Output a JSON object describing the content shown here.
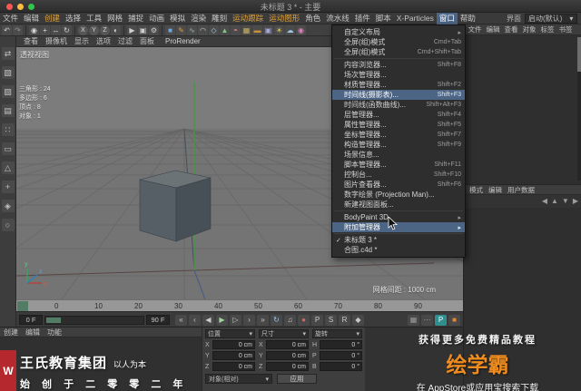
{
  "titlebar": {
    "title": "未标题 3 * - 主要"
  },
  "menubar": {
    "items": [
      "文件",
      "编辑",
      "创建",
      "选择",
      "工具",
      "网格",
      "捕捉",
      "动画",
      "模拟",
      "渲染",
      "雕刻",
      "运动跟踪",
      "运动图形",
      "角色",
      "流水线",
      "插件",
      "脚本",
      "X-Particles",
      "窗口",
      "帮助"
    ],
    "active_item": "窗口",
    "orange_items": [
      "创建",
      "运动跟踪",
      "运动图形"
    ],
    "interface_label": "界面",
    "layout_value": "启动(默认)"
  },
  "glyphs": {
    "check": "✓",
    "submenu_arrow": "▸",
    "dropdown_arrow": "▾"
  },
  "window_menu": {
    "items": [
      {
        "label": "自定义布局",
        "submenu": true
      },
      {
        "label": "全屏(组)模式",
        "shortcut": "Cmd+Tab"
      },
      {
        "label": "全屏(组)模式",
        "shortcut": "Cmd+Shift+Tab",
        "sep": true
      },
      {
        "label": "内容浏览器...",
        "shortcut": "Shift+F8"
      },
      {
        "label": "场次管理器..."
      },
      {
        "label": "材质管理器...",
        "shortcut": "Shift+F2"
      },
      {
        "label": "时间线(摄影表)...",
        "shortcut": "Shift+F3",
        "highlighted": true
      },
      {
        "label": "时间线(函数曲线)...",
        "shortcut": "Shift+Alt+F3"
      },
      {
        "label": "层管理器...",
        "shortcut": "Shift+F4"
      },
      {
        "label": "属性管理器...",
        "shortcut": "Shift+F5"
      },
      {
        "label": "坐标管理器...",
        "shortcut": "Shift+F7"
      },
      {
        "label": "构造管理器...",
        "shortcut": "Shift+F9"
      },
      {
        "label": "场景信息..."
      },
      {
        "label": "脚本管理器...",
        "shortcut": "Shift+F11"
      },
      {
        "label": "控制台...",
        "shortcut": "Shift+F10"
      },
      {
        "label": "图片查看器...",
        "shortcut": "Shift+F6"
      },
      {
        "label": "数字绘景 (Projection Man)..."
      },
      {
        "label": "新建视图面板...",
        "sep": true
      },
      {
        "label": "BodyPaint 3D",
        "submenu": true
      },
      {
        "label": "附加管理器",
        "submenu": true,
        "hovered": true,
        "sep": true
      },
      {
        "label": "未标题 3 *",
        "checked": true
      },
      {
        "label": "合图.c4d *"
      }
    ]
  },
  "toolbar": {
    "icons": [
      {
        "name": "undo-icon",
        "glyph": "↶",
        "color": "#d0d0d0"
      },
      {
        "name": "redo-icon",
        "glyph": "↷",
        "color": "#979797"
      },
      {
        "separator": true
      },
      {
        "name": "live-selection-icon",
        "glyph": "◉",
        "color": "#d8d8d8"
      },
      {
        "name": "move-tool-icon",
        "glyph": "+",
        "color": "#d8d8d8"
      },
      {
        "name": "scale-tool-icon",
        "glyph": "↔",
        "color": "#d8d8d8"
      },
      {
        "name": "rotate-tool-icon",
        "glyph": "↻",
        "color": "#d8d8d8"
      },
      {
        "separator": true
      },
      {
        "name": "lock-x-icon",
        "glyph": "X",
        "color": "#d8d8d8",
        "circle": true
      },
      {
        "name": "lock-y-icon",
        "glyph": "Y",
        "color": "#d8d8d8",
        "circle": true
      },
      {
        "name": "lock-z-icon",
        "glyph": "Z",
        "color": "#d8d8d8",
        "circle": true
      },
      {
        "name": "coordinate-system-icon",
        "glyph": "◐",
        "color": "#d8d8d8"
      },
      {
        "separator": true
      },
      {
        "name": "render-view-icon",
        "glyph": "▶",
        "color": "#cfcfcf"
      },
      {
        "name": "render-picture-viewer-icon",
        "glyph": "▣",
        "color": "#cfcfcf"
      },
      {
        "name": "render-settings-icon",
        "glyph": "⚙",
        "color": "#cfcfcf"
      },
      {
        "separator": true
      },
      {
        "name": "add-cube-icon",
        "glyph": "■",
        "color": "#6fa8dc"
      },
      {
        "name": "add-pen-icon",
        "glyph": "✎",
        "color": "#d8a23c"
      },
      {
        "name": "add-spline-icon",
        "glyph": "∿",
        "color": "#8cc98c"
      },
      {
        "name": "add-arc-icon",
        "glyph": "◠",
        "color": "#c8c8c8"
      },
      {
        "name": "add-subdivision-icon",
        "glyph": "◇",
        "color": "#9ad0e8"
      },
      {
        "name": "add-extrude-icon",
        "glyph": "▲",
        "color": "#84c784"
      },
      {
        "name": "add-boolean-icon",
        "glyph": "◓",
        "color": "#d08484"
      },
      {
        "name": "add-array-icon",
        "glyph": "▦",
        "color": "#c8b060"
      },
      {
        "name": "add-floor-icon",
        "glyph": "▬",
        "color": "#c98f3b"
      },
      {
        "name": "add-camera-icon",
        "glyph": "▣",
        "color": "#a8a8d8"
      },
      {
        "name": "add-light-icon",
        "glyph": "☀",
        "color": "#ecd24a"
      },
      {
        "name": "add-sky-icon",
        "glyph": "☁",
        "color": "#9ec7ec"
      },
      {
        "name": "add-material-icon",
        "glyph": "◉",
        "color": "#d884b8"
      }
    ]
  },
  "left_toolbar": {
    "icons": [
      {
        "name": "convert-tool-icon",
        "glyph": "⇄"
      },
      {
        "name": "model-mode-icon",
        "glyph": "▧"
      },
      {
        "name": "texture-mode-icon",
        "glyph": "▨"
      },
      {
        "name": "workplane-mode-icon",
        "glyph": "▤"
      },
      {
        "name": "points-mode-icon",
        "glyph": "∷"
      },
      {
        "name": "edges-mode-icon",
        "glyph": "▭"
      },
      {
        "name": "polygons-mode-icon",
        "glyph": "△"
      },
      {
        "name": "enable-axis-icon",
        "glyph": "+"
      },
      {
        "name": "snap-icon",
        "glyph": "◈"
      },
      {
        "name": "magnet-icon",
        "glyph": "○"
      }
    ]
  },
  "viewport": {
    "title": "透视视图",
    "menu": [
      "查看",
      "摄像机",
      "显示",
      "选项",
      "过滤",
      "面板"
    ],
    "prorender_label": "ProRender",
    "hud_lines": [
      "三角形 : 24",
      "多边形 : 6",
      "顶点 : 8",
      "对象 : 1"
    ],
    "grid_spacing": "网格间距 : 1000 cm",
    "axis_labels": [
      "x",
      "y",
      "z"
    ]
  },
  "object_manager": {
    "menu": [
      "文件",
      "编辑",
      "查看",
      "对象",
      "标签",
      "书签"
    ]
  },
  "attribute_manager": {
    "menu": [
      "模式",
      "编辑",
      "用户数据"
    ],
    "nav_icons": [
      "◀",
      "▲",
      "▼",
      "▶"
    ]
  },
  "timeline": {
    "ticks": [
      "0",
      "10",
      "20",
      "30",
      "40",
      "50",
      "60",
      "70",
      "80",
      "90"
    ],
    "start_field": "0 F",
    "end_field": "90 F"
  },
  "transport": {
    "buttons": [
      {
        "name": "goto-start-button",
        "glyph": "«"
      },
      {
        "name": "prev-key-button",
        "glyph": "‹"
      },
      {
        "name": "prev-frame-button",
        "glyph": "◀"
      },
      {
        "name": "play-button",
        "glyph": "▶",
        "color": "#9fd49f"
      },
      {
        "name": "next-frame-button",
        "glyph": "▷"
      },
      {
        "name": "next-key-button",
        "glyph": "›"
      },
      {
        "name": "goto-end-button",
        "glyph": "»"
      },
      {
        "name": "loop-button",
        "glyph": "↻",
        "color": "#9fc4e8"
      },
      {
        "name": "sound-button",
        "glyph": "♫"
      },
      {
        "name": "record-button",
        "glyph": "●",
        "color": "#e06060"
      },
      {
        "name": "key-position-button",
        "glyph": "P"
      },
      {
        "name": "key-scale-button",
        "glyph": "S"
      },
      {
        "name": "key-rotation-button",
        "glyph": "R"
      },
      {
        "name": "key-parameter-button",
        "glyph": "◆",
        "color": "#c8c8c8"
      }
    ],
    "right_icons": [
      {
        "name": "solo-icon",
        "glyph": "▦",
        "color": "#9a9a9a"
      },
      {
        "name": "options-dots-icon",
        "glyph": "⋯",
        "color": "#9a9a9a"
      },
      {
        "name": "prorender-badge",
        "glyph": "P",
        "color": "#ffffff",
        "bg": "#2f8f8f"
      },
      {
        "name": "plugin-badge",
        "glyph": "■",
        "color": "#e8872b"
      }
    ]
  },
  "material_manager": {
    "menu": [
      "创建",
      "编辑",
      "功能"
    ]
  },
  "coordinate_manager": {
    "columns": [
      {
        "title": "位置",
        "rows": [
          [
            "X",
            "0 cm"
          ],
          [
            "Y",
            "0 cm"
          ],
          [
            "Z",
            "0 cm"
          ]
        ]
      },
      {
        "title": "尺寸",
        "rows": [
          [
            "X",
            "0 cm"
          ],
          [
            "Y",
            "0 cm"
          ],
          [
            "Z",
            "0 cm"
          ]
        ]
      },
      {
        "title": "旋转",
        "rows": [
          [
            "H",
            "0 °"
          ],
          [
            "P",
            "0 °"
          ],
          [
            "B",
            "0 °"
          ]
        ]
      }
    ],
    "mode_value": "对象(相对)",
    "apply_label": "应用"
  },
  "ads": {
    "left_logo": "W",
    "left_title": "王氏教育集团",
    "left_slogan": "以人为本",
    "left_sub": "始 创 于 二 零 零 二 年",
    "right_line1": "获得更多免费精品教程",
    "right_brand": "绘学霸",
    "right_line2": "在 AppStore或应用宝搜索下载"
  },
  "colors": {
    "accent_orange": "#e8872b",
    "menu_highlight": "#4d6585",
    "brand_orange": "#f08c1e",
    "banner_red": "#b5282d",
    "viewport_gray": "#767676"
  }
}
